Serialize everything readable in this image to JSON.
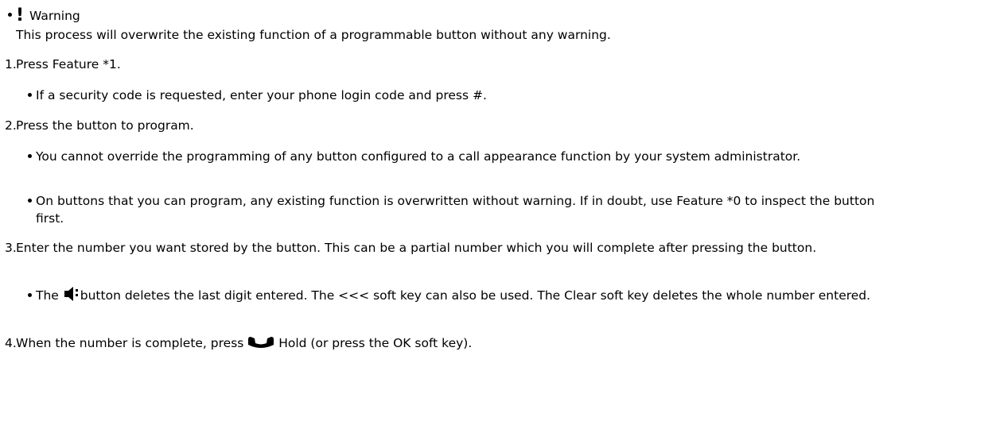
{
  "warning": {
    "symbol": "!",
    "title": "Warning",
    "text": "This process will overwrite the existing function of a programmable button without any warning."
  },
  "steps": [
    {
      "number": "1.",
      "text": "Press Feature *1.",
      "sub": [
        "If a security code is requested, enter your phone login code and press #."
      ]
    },
    {
      "number": "2.",
      "text": "Press the button to program.",
      "sub": [
        "You cannot override the programming of any button configured to a call appearance function by your system administrator.",
        "On buttons that you can program, any existing function is overwritten without warning. If in doubt, use Feature *0 to inspect the button first."
      ]
    },
    {
      "number": "3.",
      "text": "Enter the number you want stored by the button. This can be a partial number which you will complete after pressing the button.",
      "sub_parts": {
        "pre": "The",
        "icon": "speaker-icon",
        "post": "button deletes the last digit entered. The <<< soft key can also be used. The Clear soft key deletes the whole number entered."
      }
    },
    {
      "number": "4.",
      "pre": "When the number is complete, press",
      "icon": "handset-hold-icon",
      "post": "Hold (or press the OK soft key)."
    }
  ]
}
